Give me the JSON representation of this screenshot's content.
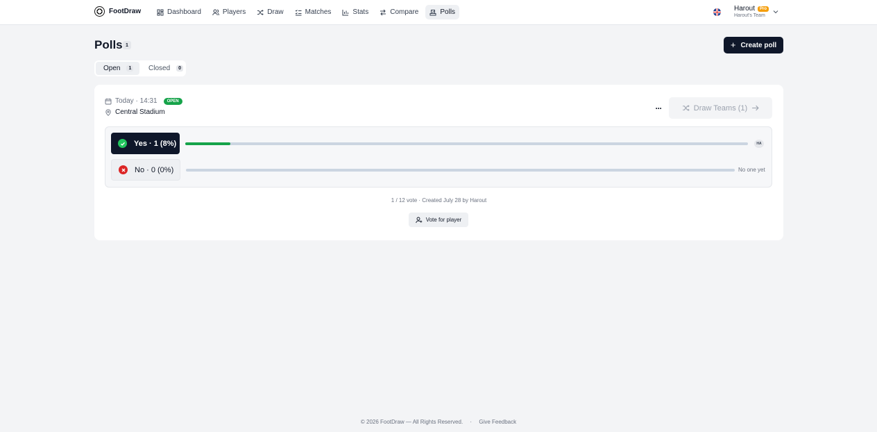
{
  "app": {
    "name": "FootDraw"
  },
  "nav": {
    "items": [
      {
        "label": "Dashboard",
        "icon": "dashboard-icon"
      },
      {
        "label": "Players",
        "icon": "players-icon"
      },
      {
        "label": "Draw",
        "icon": "shuffle-icon"
      },
      {
        "label": "Matches",
        "icon": "list-check-icon"
      },
      {
        "label": "Stats",
        "icon": "bar-chart-icon"
      },
      {
        "label": "Compare",
        "icon": "compare-icon"
      },
      {
        "label": "Polls",
        "icon": "ballot-icon"
      }
    ],
    "active": "Polls"
  },
  "user": {
    "name": "Harout",
    "badge": "Pro",
    "team": "Harout's Team"
  },
  "page": {
    "title": "Polls",
    "count": "1",
    "create_label": "Create poll"
  },
  "tabs": [
    {
      "label": "Open",
      "count": "1"
    },
    {
      "label": "Closed",
      "count": "0"
    }
  ],
  "poll": {
    "date": "Today · 14:31",
    "status": "OPEN",
    "location": "Central Stadium",
    "more_label": "···",
    "draw_label": "Draw Teams (1)",
    "options": [
      {
        "label": "Yes · 1 (8%)",
        "percent": 8,
        "voters": [
          "HA"
        ]
      },
      {
        "label": "No · 0 (0%)",
        "percent": 0,
        "empty_text": "No one yet"
      }
    ],
    "summary": "1 / 12 vote · Created July 28 by Harout",
    "vote_for_player_label": "Vote for player"
  },
  "footer": {
    "copyright": "© 2026 FootDraw — All Rights Reserved.",
    "separator": "·",
    "feedback": "Give Feedback"
  },
  "colors": {
    "accent": "#16a34a",
    "dark": "#0f172a",
    "pro": "#f59e0b",
    "danger": "#dc2626"
  }
}
